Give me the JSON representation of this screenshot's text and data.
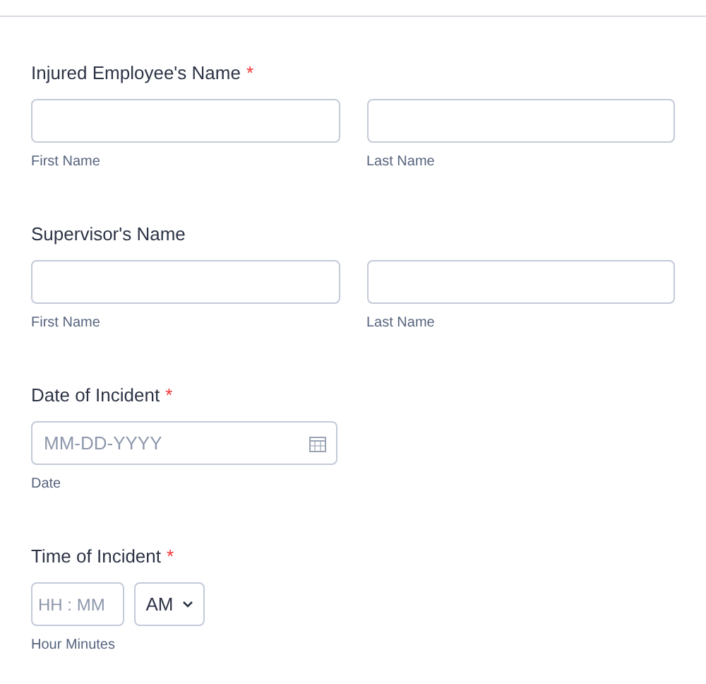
{
  "sections": [
    {
      "kind": "name",
      "label": "Injured Employee's Name",
      "required_mark": "*",
      "fields": [
        {
          "sublabel": "First Name"
        },
        {
          "sublabel": "Last Name"
        }
      ]
    },
    {
      "kind": "name",
      "label": "Supervisor's Name",
      "fields": [
        {
          "sublabel": "First Name"
        },
        {
          "sublabel": "Last Name"
        }
      ]
    },
    {
      "kind": "date",
      "label": "Date of Incident",
      "required_mark": "*",
      "placeholder": "MM-DD-YYYY",
      "sublabel": "Date"
    },
    {
      "kind": "time",
      "label": "Time of Incident",
      "required_mark": "*",
      "placeholder": "HH : MM",
      "ampm": "AM",
      "sublabel": "Hour Minutes"
    }
  ]
}
